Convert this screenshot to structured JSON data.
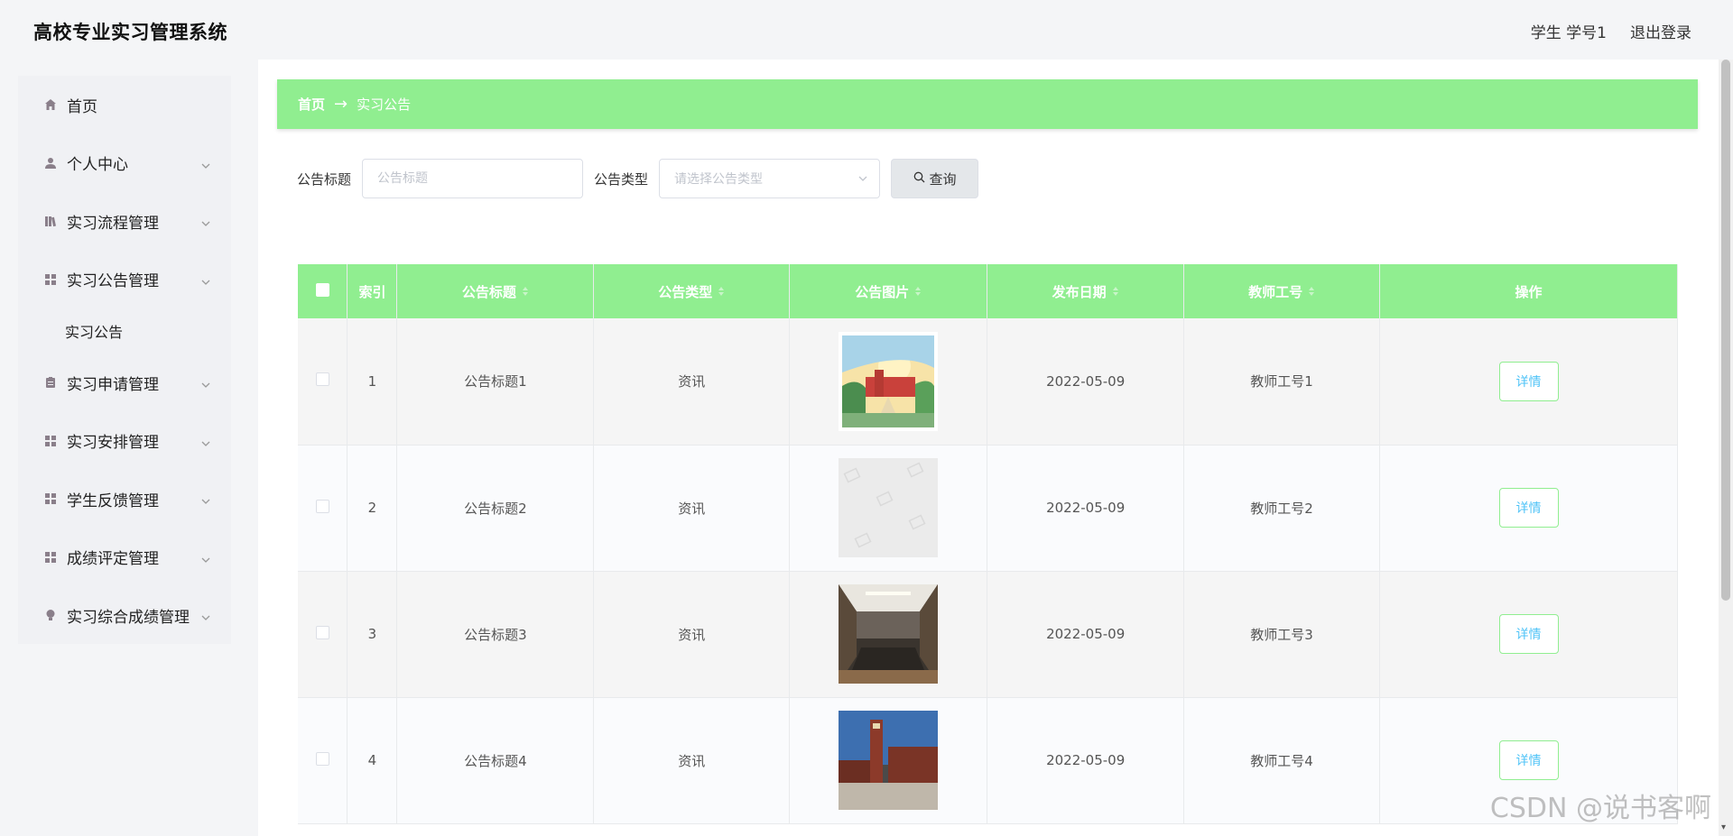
{
  "header": {
    "app_title": "高校专业实习管理系统",
    "user_label": "学生 学号1",
    "logout_label": "退出登录"
  },
  "sidebar": {
    "items": [
      {
        "label": "首页",
        "icon": "home-icon",
        "expandable": false
      },
      {
        "label": "个人中心",
        "icon": "user-icon",
        "expandable": true
      },
      {
        "label": "实习流程管理",
        "icon": "books-icon",
        "expandable": true
      },
      {
        "label": "实习公告管理",
        "icon": "grid-icon",
        "expandable": true
      },
      {
        "label": "实习申请管理",
        "icon": "clipboard-icon",
        "expandable": true
      },
      {
        "label": "实习安排管理",
        "icon": "grid-icon",
        "expandable": true
      },
      {
        "label": "学生反馈管理",
        "icon": "grid-icon",
        "expandable": true
      },
      {
        "label": "成绩评定管理",
        "icon": "grid-icon",
        "expandable": true
      },
      {
        "label": "实习综合成绩管理",
        "icon": "bulb-icon",
        "expandable": true
      }
    ],
    "sub_item_label": "实习公告"
  },
  "breadcrumb": {
    "home": "首页",
    "arrow": "→",
    "current": "实习公告"
  },
  "search": {
    "title_label": "公告标题",
    "title_placeholder": "公告标题",
    "type_label": "公告类型",
    "type_placeholder": "请选择公告类型",
    "query_label": "查询"
  },
  "table": {
    "columns": [
      "索引",
      "公告标题",
      "公告类型",
      "公告图片",
      "发布日期",
      "教师工号",
      "操作"
    ],
    "rows": [
      {
        "index": "1",
        "title": "公告标题1",
        "type": "资讯",
        "image": "campus-painting",
        "date": "2022-05-09",
        "teacher": "教师工号1",
        "action": "详情"
      },
      {
        "index": "2",
        "title": "公告标题2",
        "type": "资讯",
        "image": "placeholder",
        "date": "2022-05-09",
        "teacher": "教师工号2",
        "action": "详情"
      },
      {
        "index": "3",
        "title": "公告标题3",
        "type": "资讯",
        "image": "meeting-room",
        "date": "2022-05-09",
        "teacher": "教师工号3",
        "action": "详情"
      },
      {
        "index": "4",
        "title": "公告标题4",
        "type": "资讯",
        "image": "campus-building",
        "date": "2022-05-09",
        "teacher": "教师工号4",
        "action": "详情"
      }
    ]
  },
  "watermark": "CSDN @说书客啊",
  "colors": {
    "accent": "#90ee90",
    "link": "#4fc3f7"
  }
}
